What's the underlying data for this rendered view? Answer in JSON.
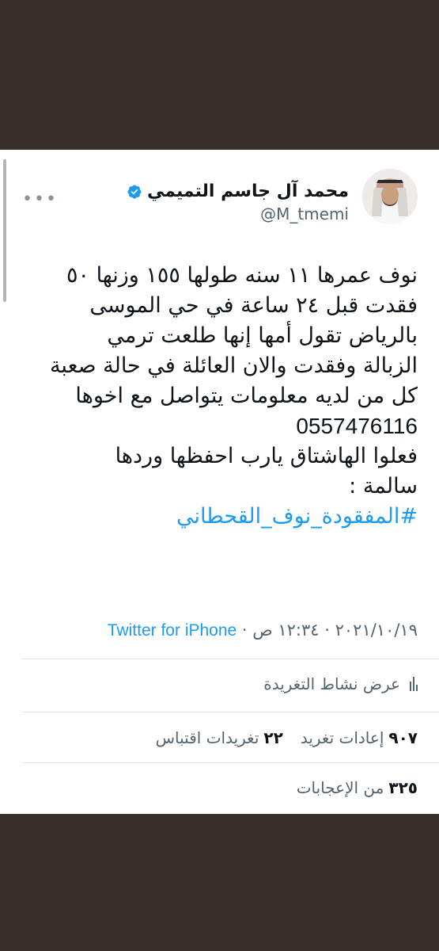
{
  "author": {
    "display_name": "محمد آل جاسم التميمي",
    "handle": "@M_tmemi"
  },
  "tweet": {
    "lines": [
      "نوف عمرها ١١ سنه طولها ١٥٥ وزنها ٥٠",
      "فقدت قبل ٢٤ ساعة في حي الموسى",
      "بالرياض تقول أمها إنها طلعت ترمي",
      "الزبالة وفقدت والان العائلة في حالة صعبة",
      "كل من لديه معلومات يتواصل مع اخوها"
    ],
    "phone": "0557476116",
    "lines2": [
      "فعلوا الهاشتاق يارب احفظها وردها",
      "سالمة :"
    ],
    "hashtag": "#المفقودة_نوف_القحطاني"
  },
  "meta": {
    "date": "٢٠٢١/١٠/١٩",
    "separator": "·",
    "time": "١٢:٣٤ ص",
    "source": "Twitter for iPhone"
  },
  "activity": {
    "label": "عرض نشاط التغريدة"
  },
  "stats": {
    "retweets_num": "٩٠٧",
    "retweets_label": "إعادات تغريد",
    "quotes_num": "٢٢",
    "quotes_label": "تغريدات اقتباس",
    "likes_num": "٣٢٥",
    "likes_label": "من الإعجابات"
  },
  "colors": {
    "accent": "#1d9bf0",
    "background": "#3a302b"
  }
}
